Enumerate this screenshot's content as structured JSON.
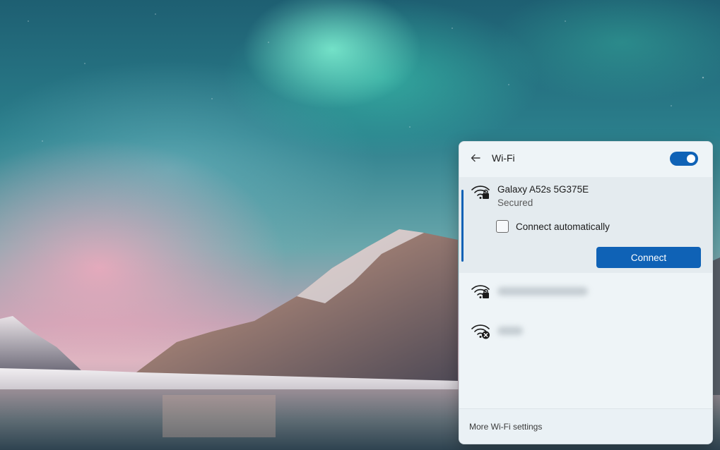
{
  "wifi_panel": {
    "title": "Wi-Fi",
    "wifi_enabled": true,
    "selected_network": {
      "name": "Galaxy A52s 5G375E",
      "status": "Secured",
      "connect_automatically_label": "Connect automatically",
      "connect_automatically_checked": false,
      "connect_button_label": "Connect",
      "icon": "wifi-secured-icon"
    },
    "other_networks": [
      {
        "icon": "wifi-secured-icon",
        "name_obscured": true
      },
      {
        "icon": "wifi-no-internet-icon",
        "name_obscured": true
      }
    ],
    "footer_link": "More Wi-Fi settings"
  },
  "colors": {
    "accent": "#0f62b6",
    "panel_bg": "#eef4f7",
    "selected_bg": "#e4ebef"
  }
}
